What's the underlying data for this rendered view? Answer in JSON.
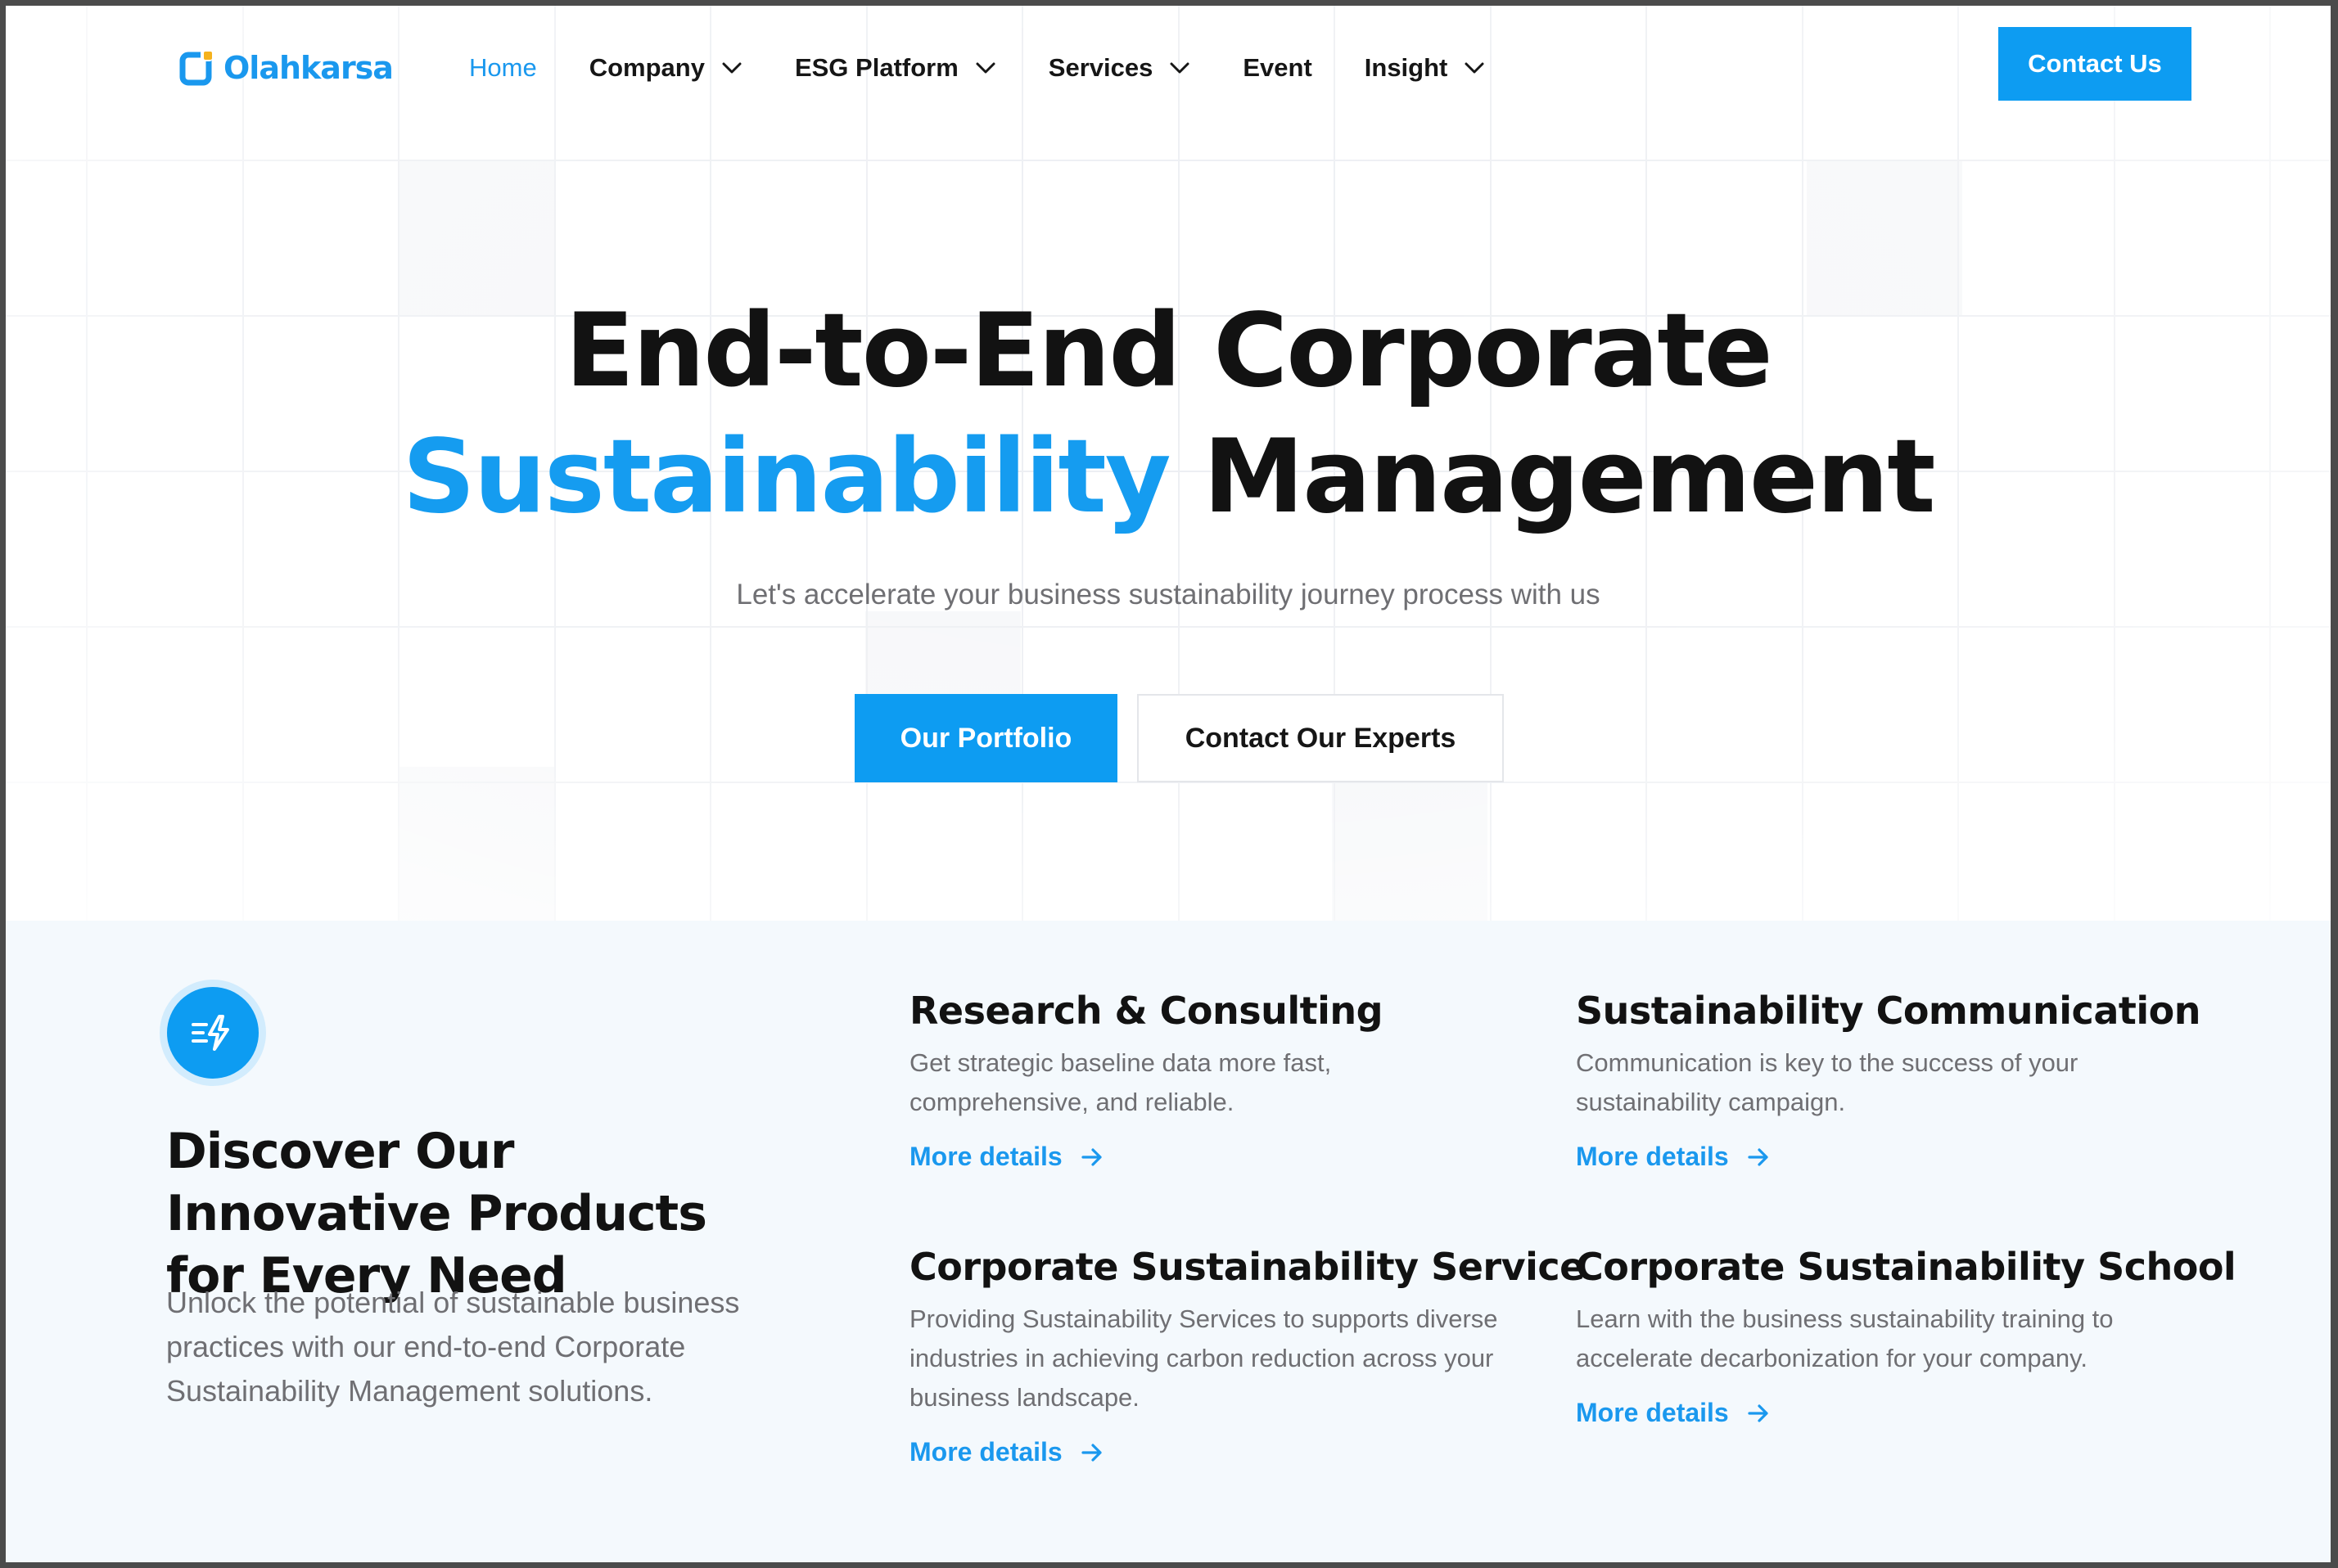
{
  "brand": {
    "name": "Olahkarsa",
    "logo_icon": "logo-mark-icon",
    "primary_color": "#0d9cf2",
    "text_color": "#121212",
    "muted_color": "#6f6f73"
  },
  "nav": {
    "items": [
      {
        "label": "Home",
        "active": true,
        "has_dropdown": false
      },
      {
        "label": "Company",
        "active": false,
        "has_dropdown": true
      },
      {
        "label": "ESG Platform",
        "active": false,
        "has_dropdown": true
      },
      {
        "label": "Services",
        "active": false,
        "has_dropdown": true
      },
      {
        "label": "Event",
        "active": false,
        "has_dropdown": false
      },
      {
        "label": "Insight",
        "active": false,
        "has_dropdown": true
      }
    ],
    "contact_label": "Contact Us"
  },
  "hero": {
    "title_line1": "End-to-End Corporate",
    "title_accent": "Sustainability",
    "title_rest": " Management",
    "subtitle": "Let's accelerate your business sustainability journey process with us",
    "primary_cta": "Our Portfolio",
    "secondary_cta": "Contact Our Experts"
  },
  "products": {
    "icon": "lightning-speed-icon",
    "heading": "Discover Our Innovative Products for Every Need",
    "description": "Unlock the potential of sustainable business practices with our end-to-end Corporate Sustainability Management solutions.",
    "cards": [
      {
        "title": "Research & Consulting",
        "description": "Get strategic baseline data more fast, comprehensive, and reliable.",
        "link": "More details"
      },
      {
        "title": "Sustainability Communication",
        "description": "Communication is key to the success of your sustainability campaign.",
        "link": "More details"
      },
      {
        "title": "Corporate Sustainability Service",
        "description": "Providing Sustainability Services to supports diverse industries in achieving carbon reduction across your business landscape.",
        "link": "More details"
      },
      {
        "title": "Corporate Sustainability School",
        "description": "Learn with the business sustainability training to accelerate decarbonization for your company.",
        "link": "More details"
      }
    ]
  }
}
